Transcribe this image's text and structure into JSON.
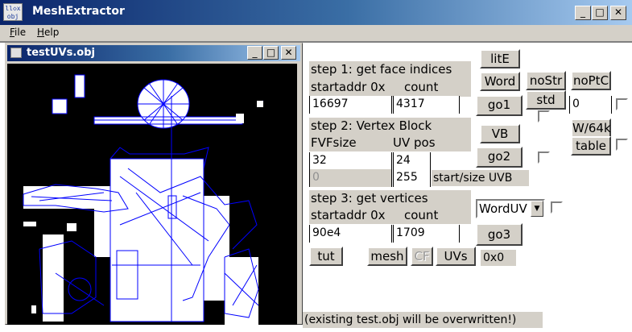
{
  "window": {
    "title": "MeshExtractor",
    "icon_text": "ll◇x obj",
    "min": "_",
    "max": "□",
    "close": "✕"
  },
  "menu": {
    "items": [
      "File",
      "Help"
    ]
  },
  "child_window": {
    "title": "testUVs.obj",
    "min": "_",
    "max": "□",
    "close": "✕"
  },
  "step1": {
    "title": "step 1: get face indices",
    "addr_label": "startaddr 0x",
    "count_label": "count",
    "addr_value": "16697",
    "count_value": "4317"
  },
  "step2": {
    "title": "step 2: Vertex Block",
    "fvf_label": "FVFsize",
    "uvpos_label": "UV pos",
    "fvf_value": "32",
    "uvpos_value": "24",
    "uvb_start": "0",
    "uvb_size": "255",
    "uvb_label": "start/size UVB"
  },
  "step3": {
    "title": "step 3: get vertices",
    "addr_label": "startaddr 0x",
    "count_label": "count",
    "addr_value": "90e4",
    "count_value": "1709"
  },
  "buttons": {
    "litE": "litE",
    "word": "Word",
    "nostr": "noStr",
    "noptc": "noPtC",
    "std": "std",
    "go1": "go1",
    "vb": "VB",
    "w64k": "W/64k",
    "table": "table",
    "go2": "go2",
    "go3": "go3",
    "tut": "tut",
    "mesh": "mesh",
    "cf": "CF",
    "uvs": "UVs"
  },
  "ptc_value": "0",
  "combo": {
    "selected": "WordUV"
  },
  "hex_readout": "0x0",
  "status": "(existing test.obj will be overwritten!)"
}
